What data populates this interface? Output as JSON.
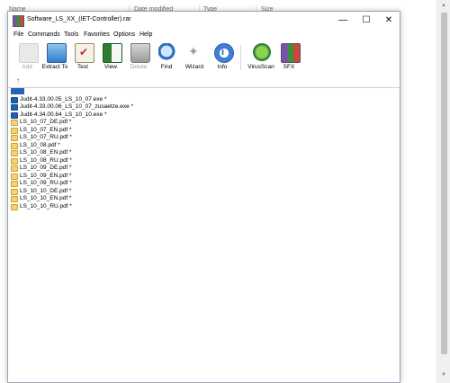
{
  "background": {
    "columns": [
      "Name",
      "Date modified",
      "Type",
      "Size"
    ]
  },
  "window": {
    "title": "Software_LS_XX_(IET-Controller).rar",
    "controls": {
      "minimize": "—",
      "maximize": "☐",
      "close": "✕"
    }
  },
  "menu": [
    "File",
    "Commands",
    "Tools",
    "Favorites",
    "Options",
    "Help"
  ],
  "toolbar": [
    {
      "label": "Add",
      "icon": "add-icon",
      "disabled": true
    },
    {
      "label": "Extract To",
      "icon": "extract-folder-icon",
      "disabled": false
    },
    {
      "label": "Test",
      "icon": "test-clipboard-icon",
      "disabled": false
    },
    {
      "label": "View",
      "icon": "view-book-icon",
      "disabled": false
    },
    {
      "label": "Delete",
      "icon": "trash-icon",
      "disabled": true
    },
    {
      "label": "Find",
      "icon": "magnifier-icon",
      "disabled": false
    },
    {
      "label": "Wizard",
      "icon": "wand-icon",
      "disabled": false
    },
    {
      "label": "Info",
      "icon": "info-icon",
      "disabled": false
    },
    {
      "label": "VirusScan",
      "icon": "virus-scan-icon",
      "disabled": false
    },
    {
      "label": "SFX",
      "icon": "sfx-icon",
      "disabled": false
    }
  ],
  "files": [
    {
      "name": "Judit-4.33.00.05_LS_10_07.exe *",
      "type": "exe"
    },
    {
      "name": "Judit-4.33.00.06_LS_10_07_zusaetze.exe *",
      "type": "exe"
    },
    {
      "name": "Judit-4.34.00.64_LS_10_10.exe *",
      "type": "exe"
    },
    {
      "name": "LS_10_07_DE.pdf *",
      "type": "pdf"
    },
    {
      "name": "LS_10_07_EN.pdf *",
      "type": "pdf"
    },
    {
      "name": "LS_10_07_RU.pdf *",
      "type": "pdf"
    },
    {
      "name": "LS_10_08.pdf *",
      "type": "pdf"
    },
    {
      "name": "LS_10_08_EN.pdf *",
      "type": "pdf"
    },
    {
      "name": "LS_10_08_RU.pdf *",
      "type": "pdf"
    },
    {
      "name": "LS_10_09_DE.pdf *",
      "type": "pdf"
    },
    {
      "name": "LS_10_09_EN.pdf *",
      "type": "pdf"
    },
    {
      "name": "LS_10_09_RU.pdf *",
      "type": "pdf"
    },
    {
      "name": "LS_10_10_DE.pdf *",
      "type": "pdf"
    },
    {
      "name": "LS_10_10_EN.pdf *",
      "type": "pdf"
    },
    {
      "name": "LS_10_10_RU.pdf *",
      "type": "pdf"
    }
  ]
}
